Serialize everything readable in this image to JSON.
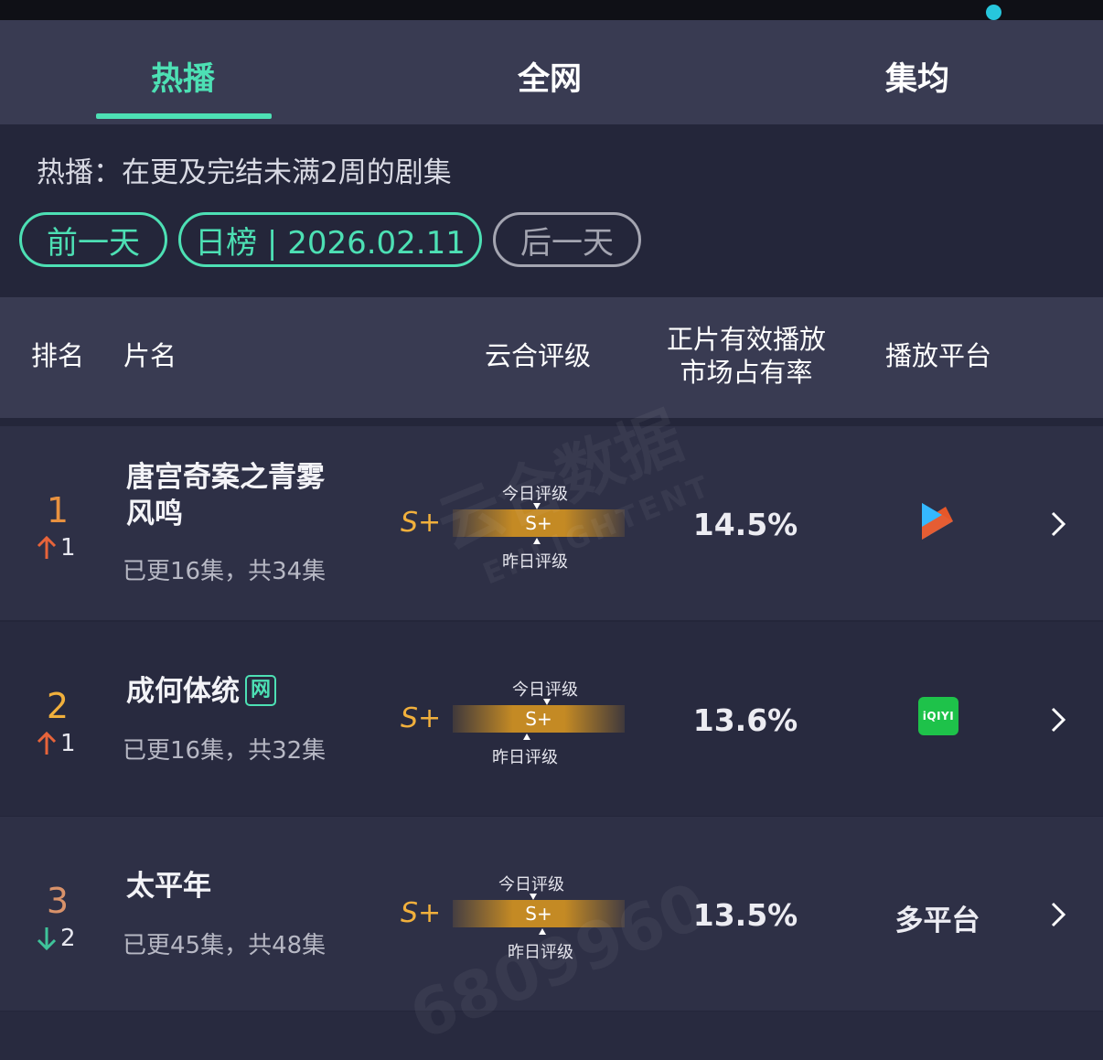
{
  "tabs": [
    {
      "label": "热播",
      "active": true
    },
    {
      "label": "全网",
      "active": false
    },
    {
      "label": "集均",
      "active": false
    }
  ],
  "description": "热播：在更及完结未满2周的剧集",
  "date_nav": {
    "prev": "前一天",
    "current": "日榜 | 2026.02.11",
    "next": "后一天"
  },
  "table_header": {
    "rank": "排名",
    "title": "片名",
    "rating": "云合评级",
    "share_line1": "正片有效播放",
    "share_line2": "市场占有率",
    "platform": "播放平台"
  },
  "marker_labels": {
    "today": "今日评级",
    "yesterday": "昨日评级"
  },
  "rows": [
    {
      "rank": "1",
      "rank_color": "#e8913f",
      "trend": "up",
      "trend_value": "1",
      "title_line1": "唐宫奇案之青雾",
      "title_line2": "风鸣",
      "episodes": "已更16集，共34集",
      "grade": "S+",
      "bar_grade": "S+",
      "share": "14.5%",
      "platform": "youku-icon"
    },
    {
      "rank": "2",
      "rank_color": "#f1b03c",
      "trend": "up",
      "trend_value": "1",
      "title_line1": "成何体统",
      "badge": "网",
      "episodes": "已更16集，共32集",
      "grade": "S+",
      "bar_grade": "S+",
      "share": "13.6%",
      "platform": "iqiyi-icon",
      "platform_logo_text": "iQIYI"
    },
    {
      "rank": "3",
      "rank_color": "#d9926a",
      "trend": "down",
      "trend_value": "2",
      "title_line1": "太平年",
      "episodes": "已更45集，共48集",
      "grade": "S+",
      "bar_grade": "S+",
      "share": "13.5%",
      "platform_text": "多平台"
    }
  ],
  "watermark": {
    "text": "云合数据",
    "sub": "ENLIGHTENT",
    "id": "6809960"
  },
  "colors": {
    "accent": "#4de0b4",
    "gold": "#f1b03c",
    "up": "#e8643a",
    "down": "#3fc39a"
  }
}
